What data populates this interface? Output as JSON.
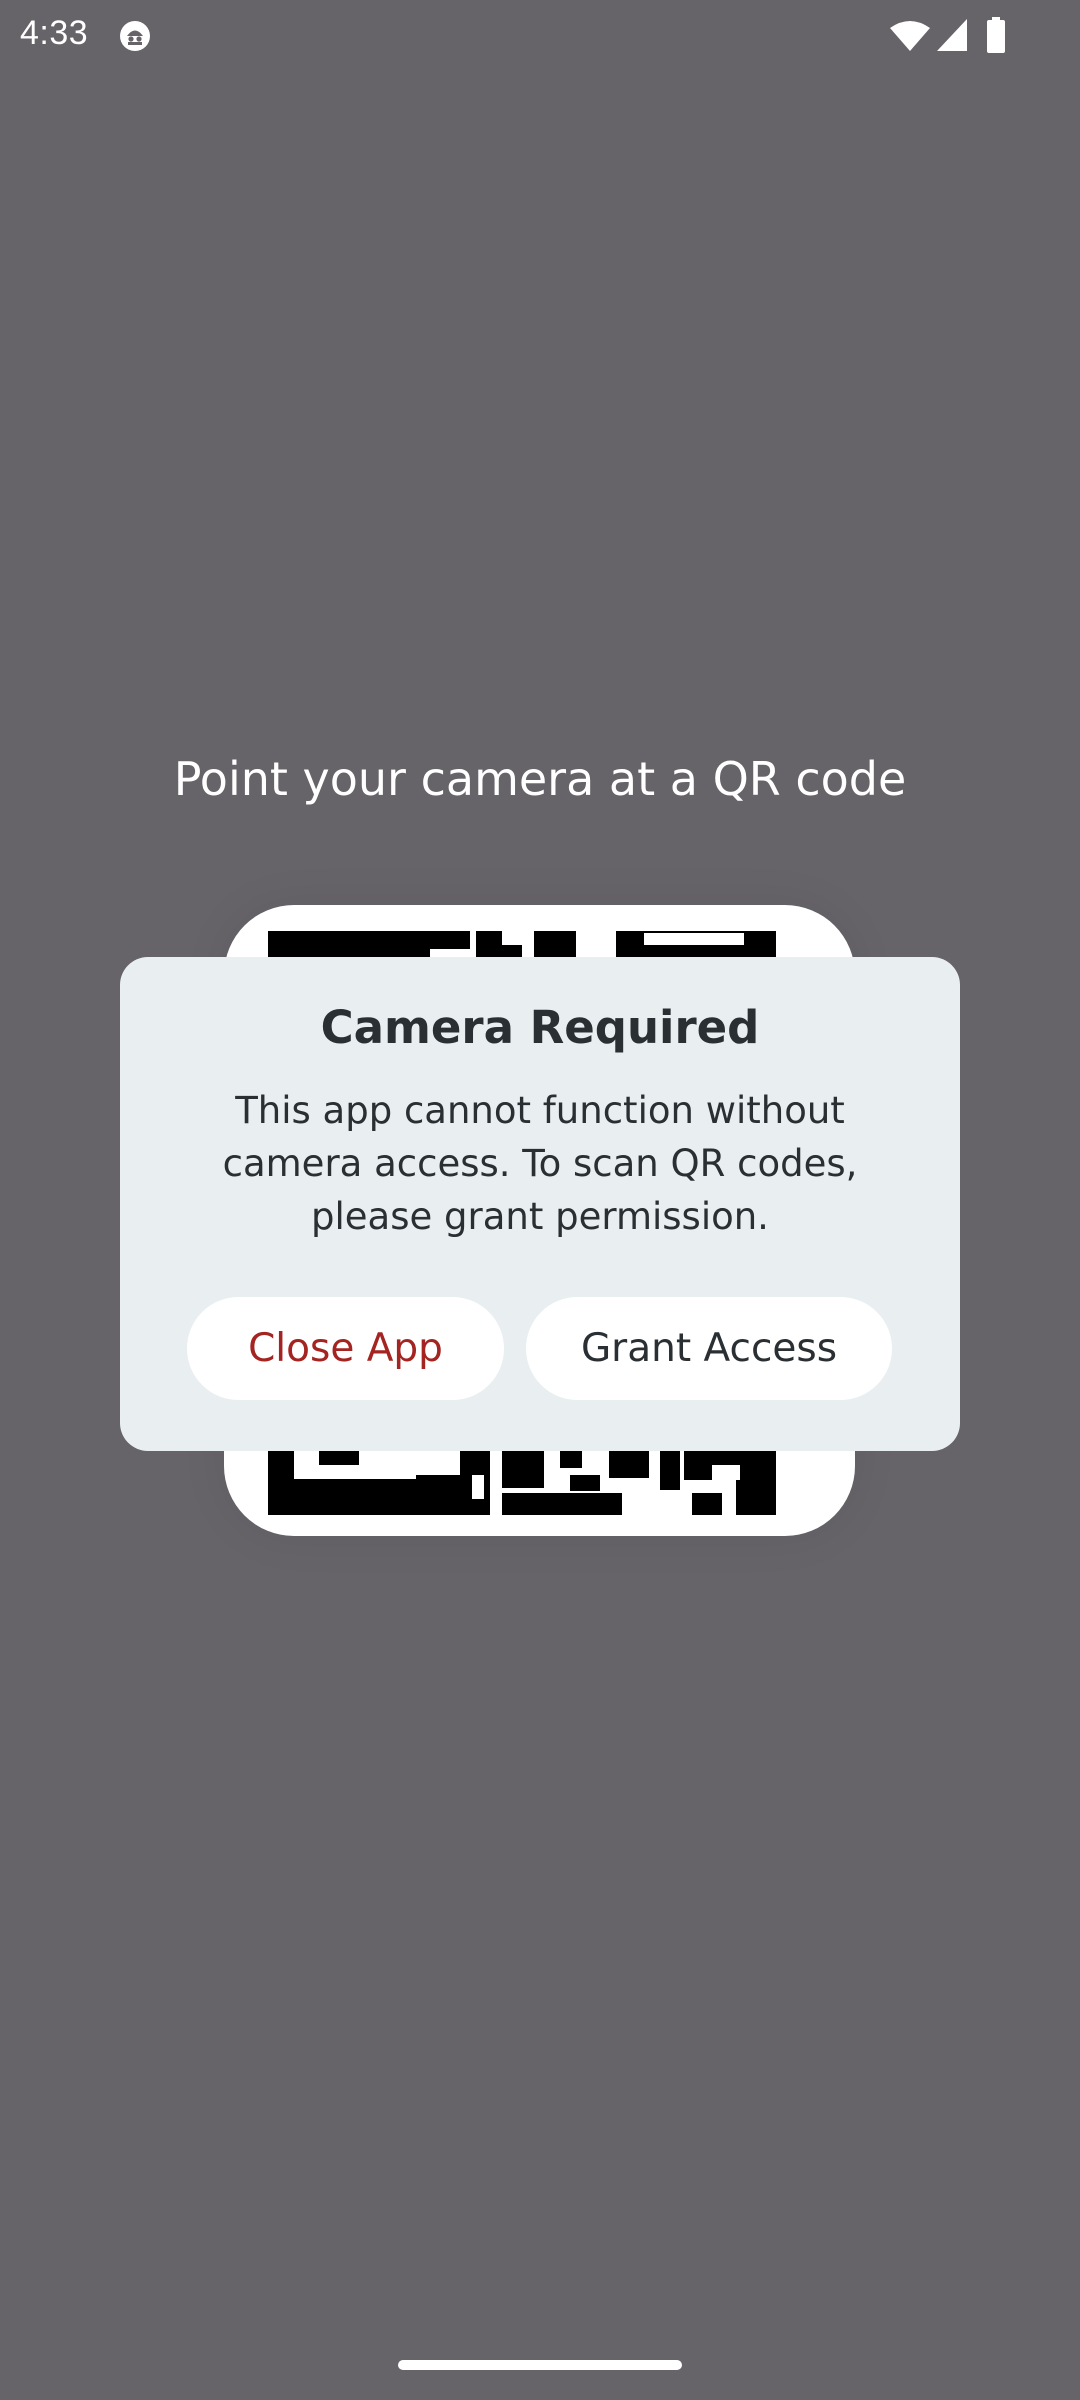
{
  "status_bar": {
    "time": "4:33",
    "icons": [
      "notification-icon",
      "wifi-icon",
      "signal-icon",
      "battery-icon"
    ]
  },
  "scanner": {
    "instruction": "Point your camera at a QR code"
  },
  "dialog": {
    "title": "Camera Required",
    "message": "This app cannot function without camera access. To scan QR codes, please grant permission.",
    "close_label": "Close App",
    "grant_label": "Grant Access"
  },
  "colors": {
    "background": "#666369",
    "dialog_background": "#e9eff1",
    "destructive": "#a32420",
    "text": "#2a2f33"
  }
}
